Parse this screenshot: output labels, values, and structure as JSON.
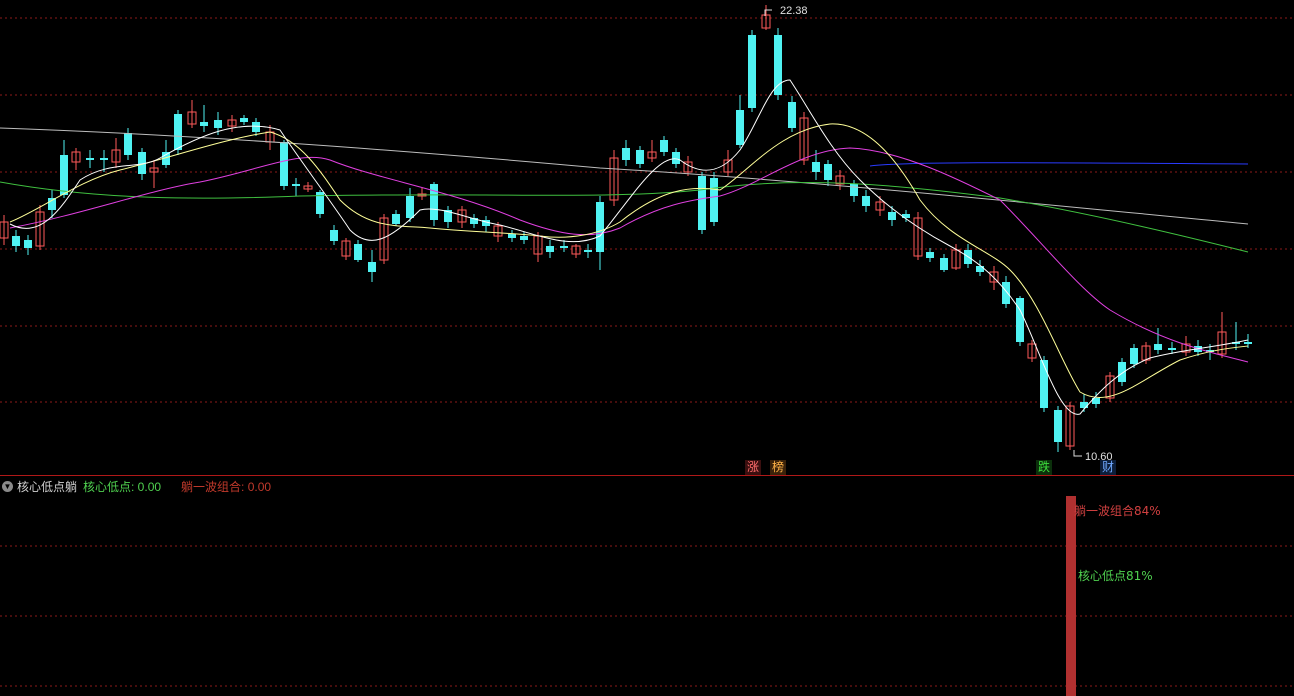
{
  "chart": {
    "high_label": "22.38",
    "low_label": "10.60",
    "tags": [
      {
        "text": "涨",
        "color": "#ff6b6b"
      },
      {
        "text": "榜",
        "color": "#ffb347"
      },
      {
        "text": "跌",
        "color": "#3ddc3d"
      },
      {
        "text": "财",
        "color": "#6fa8ff"
      }
    ]
  },
  "indicator": {
    "title": "核心低点躺",
    "value1": "核心低点: 0.00",
    "value2": "躺一波组合: 0.00",
    "bar_label1": "躺一波组合84%",
    "bar_label2": "核心低点81%"
  },
  "colors": {
    "up": "#ff5a5a",
    "down": "#4ff2f2",
    "grid": "#8b1a1a",
    "ma5": "#ffffff",
    "ma10": "#ffff99",
    "ma20": "#e040e0",
    "ma60": "#40c040",
    "ma120": "#bdbdbd",
    "ma250": "#2a3bff",
    "bar": "#b03030"
  },
  "chart_data": {
    "type": "candlestick",
    "price_high": 22.38,
    "price_low": 10.6,
    "indicator_bar_percentages": [
      84,
      81
    ]
  }
}
